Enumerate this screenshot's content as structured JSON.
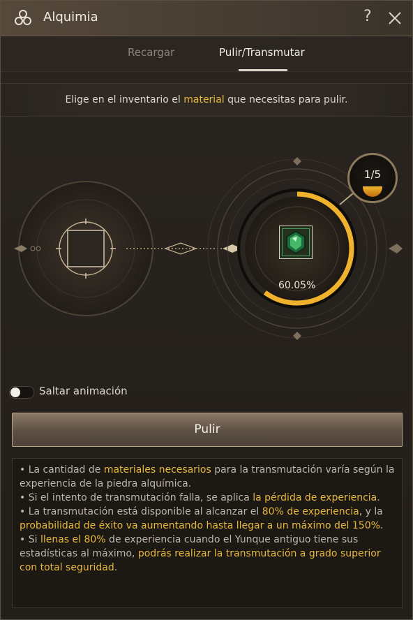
{
  "window": {
    "title": "Alquimia",
    "help_label": "?"
  },
  "tabs": [
    {
      "label": "Recargar"
    },
    {
      "label": "Pulir/Transmutar"
    }
  ],
  "notice": {
    "before": "Elige en el inventario el ",
    "highlight": "material",
    "after": " que necesitas para pulir."
  },
  "stage": {
    "progress_percent": "60.05%",
    "progress_fraction": 0.6005,
    "counter": "1/5"
  },
  "skip_animation": {
    "label": "Saltar animación",
    "enabled": false
  },
  "action": {
    "label": "Pulir"
  },
  "info": [
    {
      "parts": [
        {
          "t": "• La cantidad de "
        },
        {
          "t": "materiales necesarios",
          "hl": true
        },
        {
          "t": " para la transmutación varía según la experiencia de la piedra alquímica."
        }
      ]
    },
    {
      "parts": [
        {
          "t": "• Si el intento de transmutación falla, se aplica "
        },
        {
          "t": "la pérdida de experiencia",
          "hl": true
        },
        {
          "t": "."
        }
      ]
    },
    {
      "parts": [
        {
          "t": "• La transmutación está disponible al alcanzar el "
        },
        {
          "t": "80% de experiencia",
          "hl": true
        },
        {
          "t": ", y la "
        },
        {
          "t": "probabilidad de éxito va aumentando hasta llegar a un máximo del 150%",
          "hl": true
        },
        {
          "t": "."
        }
      ]
    },
    {
      "parts": [
        {
          "t": "• Si "
        },
        {
          "t": "llenas el 80%",
          "hl": true
        },
        {
          "t": " de experiencia cuando el Yunque antiguo tiene sus estadísticas al máximo, "
        },
        {
          "t": "podrás realizar la transmutación a grado superior con total seguridad",
          "hl": true
        },
        {
          "t": "."
        }
      ]
    }
  ],
  "colors": {
    "accent": "#e8b83c",
    "progress": "#f0b22c"
  }
}
